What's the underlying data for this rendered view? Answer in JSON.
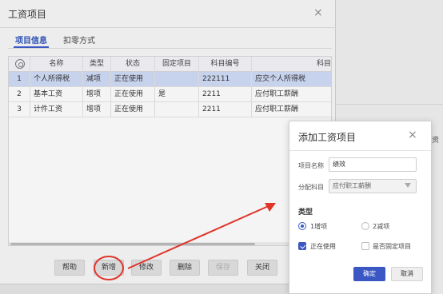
{
  "background": {
    "side_glyph": "资"
  },
  "main_dialog": {
    "title": "工资项目",
    "close_icon": "×",
    "tabs": [
      {
        "label": "项目信息",
        "active": true
      },
      {
        "label": "扣零方式",
        "active": false
      }
    ],
    "grid": {
      "settings_icon": "gear-icon",
      "columns": [
        "名称",
        "类型",
        "状态",
        "固定项目",
        "科目编号",
        "科目"
      ],
      "rows": [
        {
          "no": "1",
          "name": "个人所得税",
          "type": "减项",
          "status": "正在使用",
          "fixed": "",
          "code": "222111",
          "subject": "应交个人所得税",
          "selected": true
        },
        {
          "no": "2",
          "name": "基本工资",
          "type": "增项",
          "status": "正在使用",
          "fixed": "是",
          "code": "2211",
          "subject": "应付职工薪酬",
          "selected": false
        },
        {
          "no": "3",
          "name": "计件工资",
          "type": "增项",
          "status": "正在使用",
          "fixed": "",
          "code": "2211",
          "subject": "应付职工薪酬",
          "selected": false
        }
      ]
    },
    "buttons": {
      "help": "帮助",
      "add": "新增",
      "edit": "修改",
      "delete": "删除",
      "save": "保存",
      "close": "关闭"
    }
  },
  "add_dialog": {
    "title": "添加工资项目",
    "close_icon": "×",
    "name_label": "项目名称",
    "name_value": "绩效",
    "account_label": "分配科目",
    "account_value": "应付职工薪酬",
    "type_section": "类型",
    "type_options": [
      {
        "label": "1增项",
        "selected": true
      },
      {
        "label": "2减项",
        "selected": false
      }
    ],
    "checks": [
      {
        "label": "正在使用",
        "checked": true
      },
      {
        "label": "是否固定项目",
        "checked": false
      }
    ],
    "ok": "确定",
    "cancel": "取消"
  },
  "colors": {
    "accent": "#3a57c3",
    "selected_row": "#c7d2ec",
    "annotation": "#e0352b"
  }
}
